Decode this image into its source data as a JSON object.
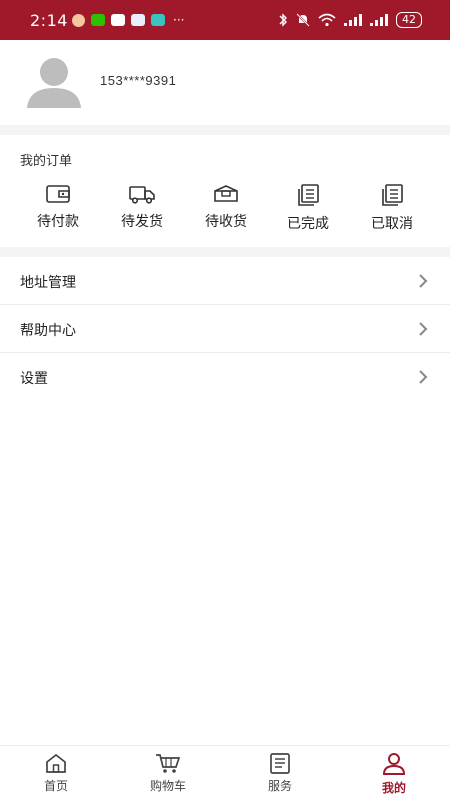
{
  "status_bar": {
    "time": "2:14",
    "battery": "42",
    "more": "···"
  },
  "profile": {
    "phone": "153****9391"
  },
  "orders": {
    "title": "我的订单",
    "items": [
      {
        "label": "待付款",
        "icon": "wallet-icon"
      },
      {
        "label": "待发货",
        "icon": "truck-icon"
      },
      {
        "label": "待收货",
        "icon": "package-icon"
      },
      {
        "label": "已完成",
        "icon": "document-stack-icon"
      },
      {
        "label": "已取消",
        "icon": "document-stack-icon"
      }
    ]
  },
  "menu": {
    "items": [
      {
        "label": "地址管理"
      },
      {
        "label": "帮助中心"
      },
      {
        "label": "设置"
      }
    ]
  },
  "bottom_nav": {
    "tabs": [
      {
        "label": "首页",
        "icon": "home-icon"
      },
      {
        "label": "购物车",
        "icon": "cart-icon"
      },
      {
        "label": "服务",
        "icon": "clipboard-icon"
      },
      {
        "label": "我的",
        "icon": "user-icon",
        "active": true
      }
    ]
  },
  "colors": {
    "brand": "#a0192b",
    "divider": "#f4f4f4"
  }
}
